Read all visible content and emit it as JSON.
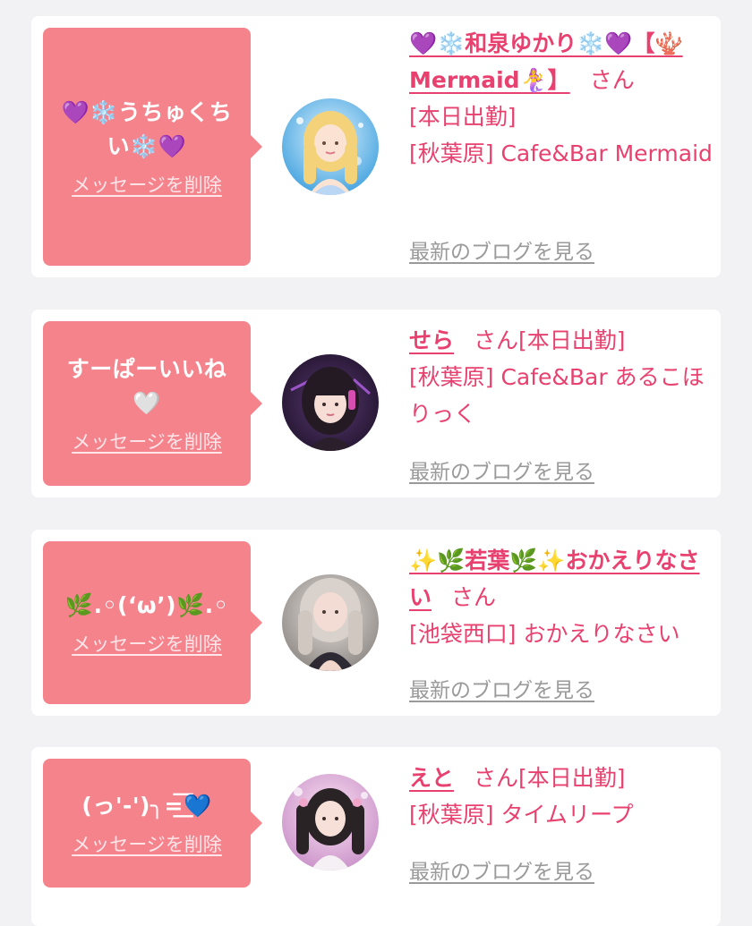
{
  "colors": {
    "page_bg": "#f2f2f4",
    "card_bg": "#ffffff",
    "bubble_bg": "#f5838c",
    "accent_pink": "#e8416f",
    "link_gray": "#9a9a9a"
  },
  "items": [
    {
      "message": "💜❄️うちゅくちい❄️💜",
      "delete_label": "メッセージを削除",
      "avatar_icon": "avatar-photo-blonde-mermaid",
      "name": "💜❄️和泉ゆかり❄️💜【🪸Mermaid🧜‍♀️】",
      "honorific": "さん",
      "lines": [
        "[本日出勤]",
        "[秋葉原] Cafe&Bar Mermaid"
      ],
      "blog_label": "最新のブログを見る"
    },
    {
      "message": "すーぱーいいね🤍",
      "delete_label": "メッセージを削除",
      "avatar_icon": "avatar-photo-dark-hair-purple",
      "name": "せら",
      "honorific": "さん",
      "lines": [
        "[本日出勤]",
        "[秋葉原] Cafe&Bar あるこほりっく"
      ],
      "blog_label": "最新のブログを見る"
    },
    {
      "message": "🌿.◦(ʻωʼ)🌿.◦",
      "delete_label": "メッセージを削除",
      "avatar_icon": "avatar-photo-light-hair",
      "name": "✨🌿若葉🌿✨おかえりなさい",
      "honorific": "さん",
      "lines": [
        "[池袋西口] おかえりなさい"
      ],
      "blog_label": "最新のブログを見る"
    },
    {
      "message": "(っ'-')╮=͟͟͞͞💙",
      "delete_label": "メッセージを削除",
      "avatar_icon": "avatar-photo-twintails-pink",
      "name": "えと",
      "honorific": "さん",
      "lines": [
        "[本日出勤]",
        "[秋葉原] タイムリープ"
      ],
      "blog_label": "最新のブログを見る"
    }
  ]
}
